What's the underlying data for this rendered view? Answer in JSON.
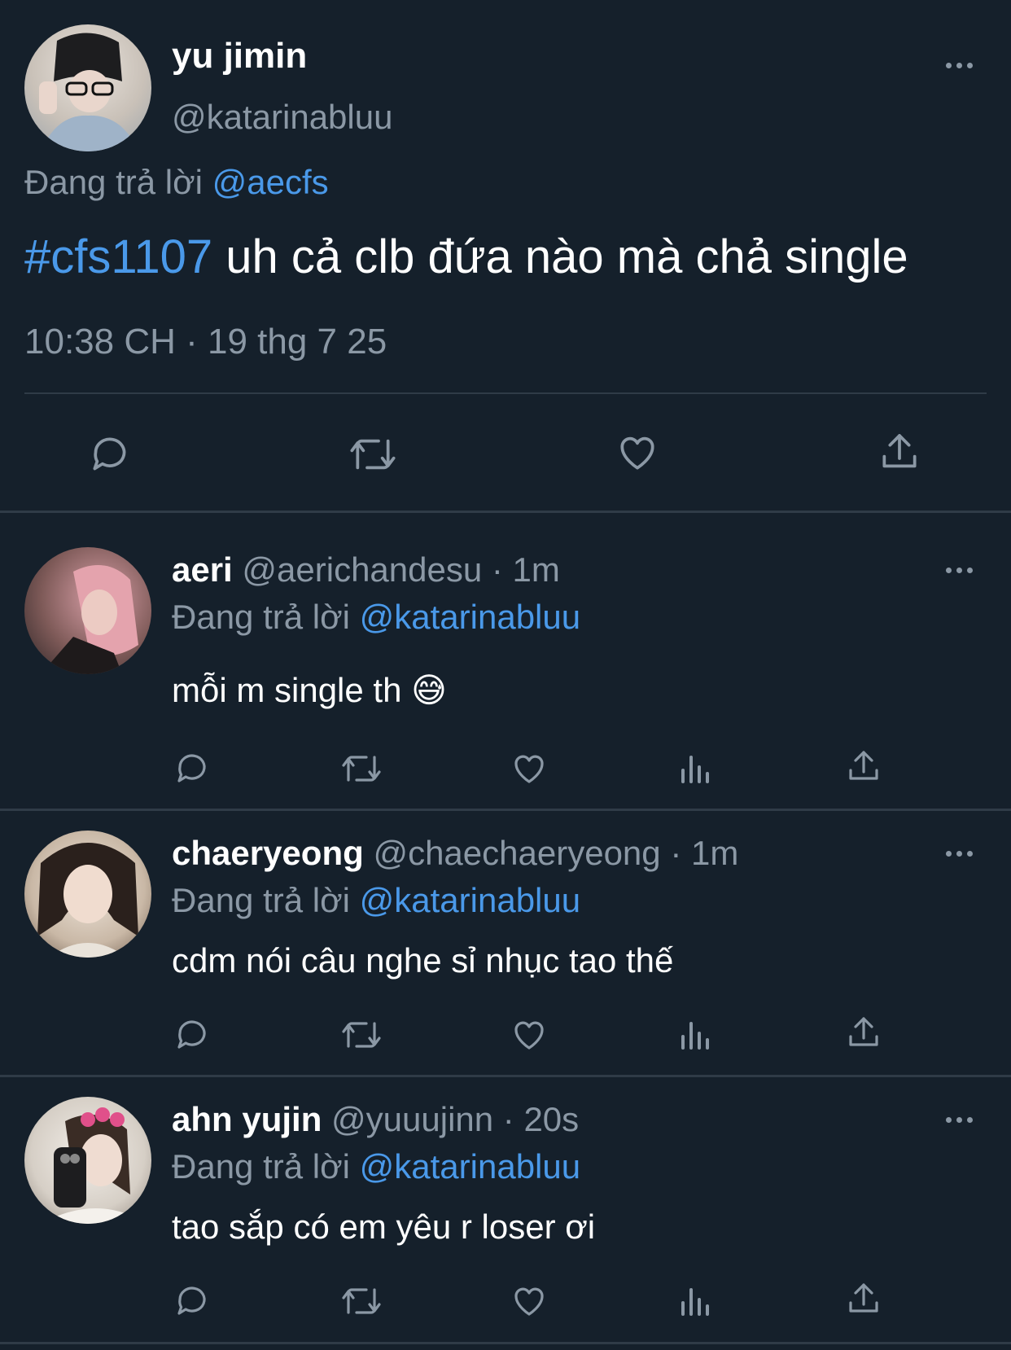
{
  "main_tweet": {
    "display_name": "yu jimin",
    "handle": "@katarinabluu",
    "reply_prefix": "Đang trả lời",
    "reply_to": "@aecfs",
    "hashtag": "#cfs1107",
    "text": " uh cả clb đứa nào mà chả single",
    "timestamp": "10:38 CH · 19 thg 7 25",
    "actions": [
      "reply-icon",
      "retweet-icon",
      "like-icon",
      "share-icon"
    ]
  },
  "replies": [
    {
      "display_name": "aeri",
      "handle": "@aerichandesu",
      "time": " · 1m",
      "reply_prefix": "Đang trả lời",
      "reply_to": "@katarinabluu",
      "text": "mỗi m single th",
      "emoji": "😅",
      "avatar_color": "#d9a0a8"
    },
    {
      "display_name": "chaeryeong",
      "handle": "@chaechaeryeong",
      "time": " · 1m",
      "reply_prefix": "Đang trả lời",
      "reply_to": "@katarinabluu",
      "text": "cdm nói câu nghe sỉ nhục tao thế",
      "avatar_color": "#c9b8a6"
    },
    {
      "display_name": "ahn yujin",
      "handle": "@yuuujinn",
      "time": " · 20s",
      "reply_prefix": "Đang trả lời",
      "reply_to": "@katarinabluu",
      "text": "tao sắp có em yêu r loser ơi",
      "avatar_color": "#d6cfc6"
    }
  ],
  "colors": {
    "background": "#15202b",
    "accent": "#4a99e9",
    "muted": "#8b98a5",
    "divider": "#2f3b47"
  }
}
